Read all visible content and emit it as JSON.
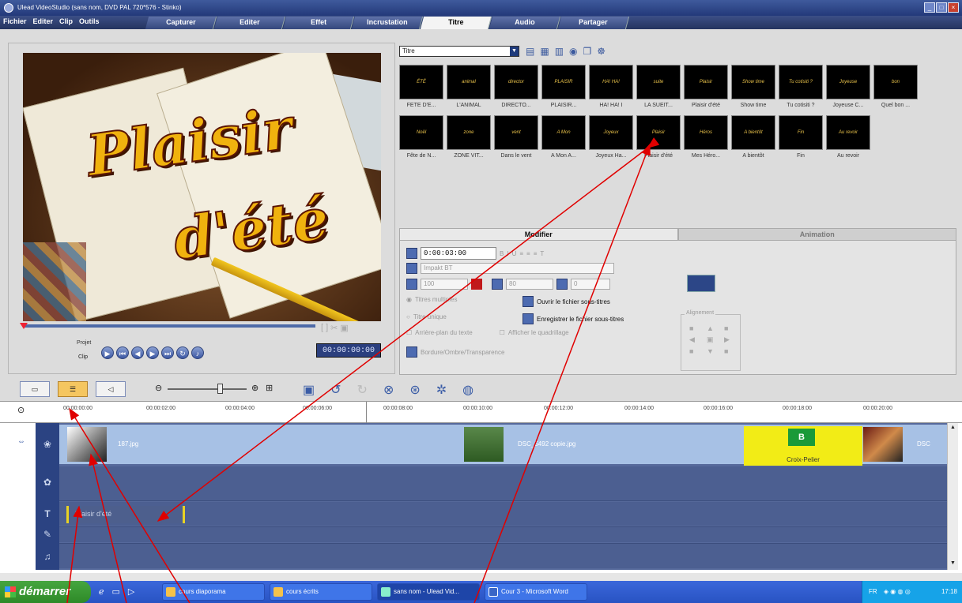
{
  "window": {
    "title": "Ulead VideoStudio (sans nom, DVD PAL 720*576 - Stinko)"
  },
  "menu": [
    "Fichier",
    "Editer",
    "Clip",
    "Outils"
  ],
  "steps": [
    "Capturer",
    "Editer",
    "Effet",
    "Incrustation",
    "Titre",
    "Audio",
    "Partager"
  ],
  "active_step": "Titre",
  "preview": {
    "title_line1": "Plaisir",
    "title_line2": "d'été",
    "project_label": "Projet",
    "clip_label": "Clip",
    "timecode": "00:00:00:00"
  },
  "library": {
    "category": "Titre",
    "thumbs": [
      {
        "label": "FETE D'E...",
        "art": "ÉTÉ"
      },
      {
        "label": "L'ANIMAL",
        "art": "animal"
      },
      {
        "label": "DIRECTO...",
        "art": "director"
      },
      {
        "label": "PLAISIR...",
        "art": "PLAISIR"
      },
      {
        "label": "HA! HA! I",
        "art": "HA! HA!"
      },
      {
        "label": "LA SUEIT...",
        "art": "suite"
      },
      {
        "label": "Plaisir d'été",
        "art": "Plaisir"
      },
      {
        "label": "Show time",
        "art": "Show time"
      },
      {
        "label": "Tu cotisiti ?",
        "art": "Tu cotisiti ?"
      },
      {
        "label": "Joyeuse C...",
        "art": "Joyeuse"
      },
      {
        "label": "Quel bon ...",
        "art": "bon"
      },
      {
        "label": "Fête de N...",
        "art": "Noël"
      },
      {
        "label": "ZONE VIT...",
        "art": "zone"
      },
      {
        "label": "Dans le vent",
        "art": "vent"
      },
      {
        "label": "A Mon A...",
        "art": "A Mon"
      },
      {
        "label": "Joyeux Ha...",
        "art": "Joyeux"
      },
      {
        "label": "Plaisir d'été",
        "art": "Plaisir"
      },
      {
        "label": "Mes Héro...",
        "art": "Héros"
      },
      {
        "label": "A bientôt",
        "art": "A bientôt"
      },
      {
        "label": "Fin",
        "art": "Fin"
      },
      {
        "label": "Au revoir",
        "art": "Au revoir"
      }
    ]
  },
  "options": {
    "tab_modify": "Modifier",
    "tab_animation": "Animation",
    "duration": "0:00:03:00",
    "font": "Impakt BT",
    "size": "100",
    "line_spacing": "80",
    "angle": "0",
    "multi_title": "Titres multiples",
    "single_title": "Titre unique",
    "open_subtitles": "Ouvrir le fichier sous-titres",
    "save_subtitles": "Enregistrer le fichier sous-titres",
    "bg_text": "Arrière-plan du texte",
    "show_grid": "Afficher le quadrillage",
    "border": "Bordure/Ombre/Transparence",
    "alignment": "Alignement"
  },
  "ruler": [
    "00:00:00:00",
    "00:00:02:00",
    "00:00:04:00",
    "00:00:06:00",
    "00:00:08:00",
    "00:00:10:00",
    "00:00:12:00",
    "00:00:14:00",
    "00:00:16:00",
    "00:00:18:00",
    "00:00:20:00"
  ],
  "timeline": {
    "clip1": "187.jpg",
    "clip2": "DSC_5492 copie.jpg",
    "clip3_name": "Croix-Pelier",
    "clip3_logo": "B",
    "clip4": "DSC",
    "title_clip": "Plaisir d'été"
  },
  "taskbar": {
    "start": "démarrer",
    "tasks": [
      "cours diaporama",
      "cours écrits",
      "sans nom - Ulead Vid...",
      "Cour 3 - Microsoft Word"
    ],
    "clock": "17:18",
    "lang": "FR"
  },
  "colors": {
    "accent_titlebar": "#23397a",
    "title_clip_border": "#e8d324",
    "annotation_arrow": "#e00000"
  }
}
